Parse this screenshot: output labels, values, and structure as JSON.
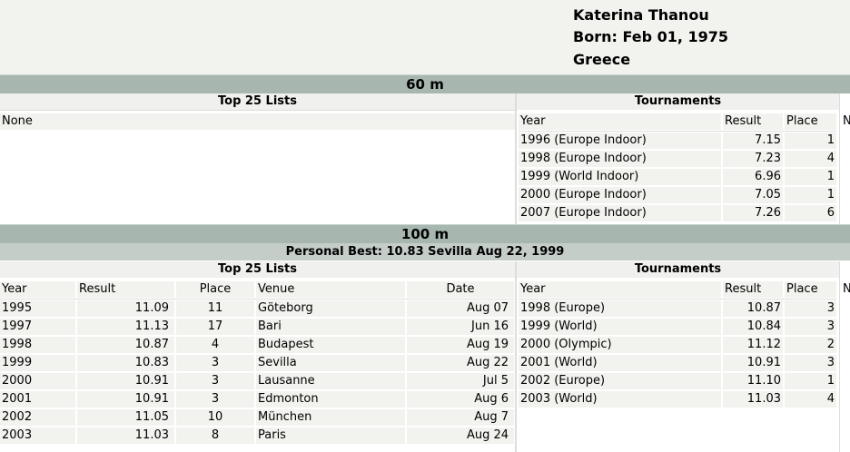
{
  "athlete": {
    "name": "Katerina Thanou",
    "born": "Born: Feb 01, 1975",
    "country": "Greece"
  },
  "events": [
    {
      "title": "60 m",
      "top25": {
        "heading": "Top 25 Lists",
        "none": "None"
      },
      "tournaments": {
        "heading": "Tournaments",
        "columns": [
          "Year",
          "Result",
          "Place",
          "N"
        ],
        "rows": [
          {
            "year": "1996 (Europe Indoor)",
            "result": "7.15",
            "place": "1"
          },
          {
            "year": "1998 (Europe Indoor)",
            "result": "7.23",
            "place": "4"
          },
          {
            "year": "1999 (World Indoor)",
            "result": "6.96",
            "place": "1"
          },
          {
            "year": "2000 (Europe Indoor)",
            "result": "7.05",
            "place": "1"
          },
          {
            "year": "2007 (Europe Indoor)",
            "result": "7.26",
            "place": "6"
          }
        ]
      }
    },
    {
      "title": "100 m",
      "personal_best": "Personal Best:  10.83  Sevilla  Aug 22, 1999",
      "top25": {
        "heading": "Top 25 Lists",
        "columns": [
          "Year",
          "Result",
          "Place",
          "Venue",
          "Date"
        ],
        "rows": [
          {
            "year": "1995",
            "result": "11.09",
            "place": "11",
            "venue": "Göteborg",
            "date": "Aug 07"
          },
          {
            "year": "1997",
            "result": "11.13",
            "place": "17",
            "venue": "Bari",
            "date": "Jun 16"
          },
          {
            "year": "1998",
            "result": "10.87",
            "place": "4",
            "venue": "Budapest",
            "date": "Aug 19"
          },
          {
            "year": "1999",
            "result": "10.83",
            "place": "3",
            "venue": "Sevilla",
            "date": "Aug 22"
          },
          {
            "year": "2000",
            "result": "10.91",
            "place": "3",
            "venue": "Lausanne",
            "date": "Jul 5"
          },
          {
            "year": "2001",
            "result": "10.91",
            "place": "3",
            "venue": "Edmonton",
            "date": "Aug 6"
          },
          {
            "year": "2002",
            "result": "11.05",
            "place": "10",
            "venue": "München",
            "date": "Aug 7"
          },
          {
            "year": "2003",
            "result": "11.03",
            "place": "8",
            "venue": "Paris",
            "date": "Aug 24"
          }
        ]
      },
      "tournaments": {
        "heading": "Tournaments",
        "columns": [
          "Year",
          "Result",
          "Place",
          "N"
        ],
        "rows": [
          {
            "year": "1998 (Europe)",
            "result": "10.87",
            "place": "3"
          },
          {
            "year": "1999 (World)",
            "result": "10.84",
            "place": "3"
          },
          {
            "year": "2000 (Olympic)",
            "result": "11.12",
            "place": "2"
          },
          {
            "year": "2001 (World)",
            "result": "10.91",
            "place": "3"
          },
          {
            "year": "2002 (Europe)",
            "result": "11.10",
            "place": "1"
          },
          {
            "year": "2003 (World)",
            "result": "11.03",
            "place": "4"
          }
        ]
      }
    }
  ]
}
